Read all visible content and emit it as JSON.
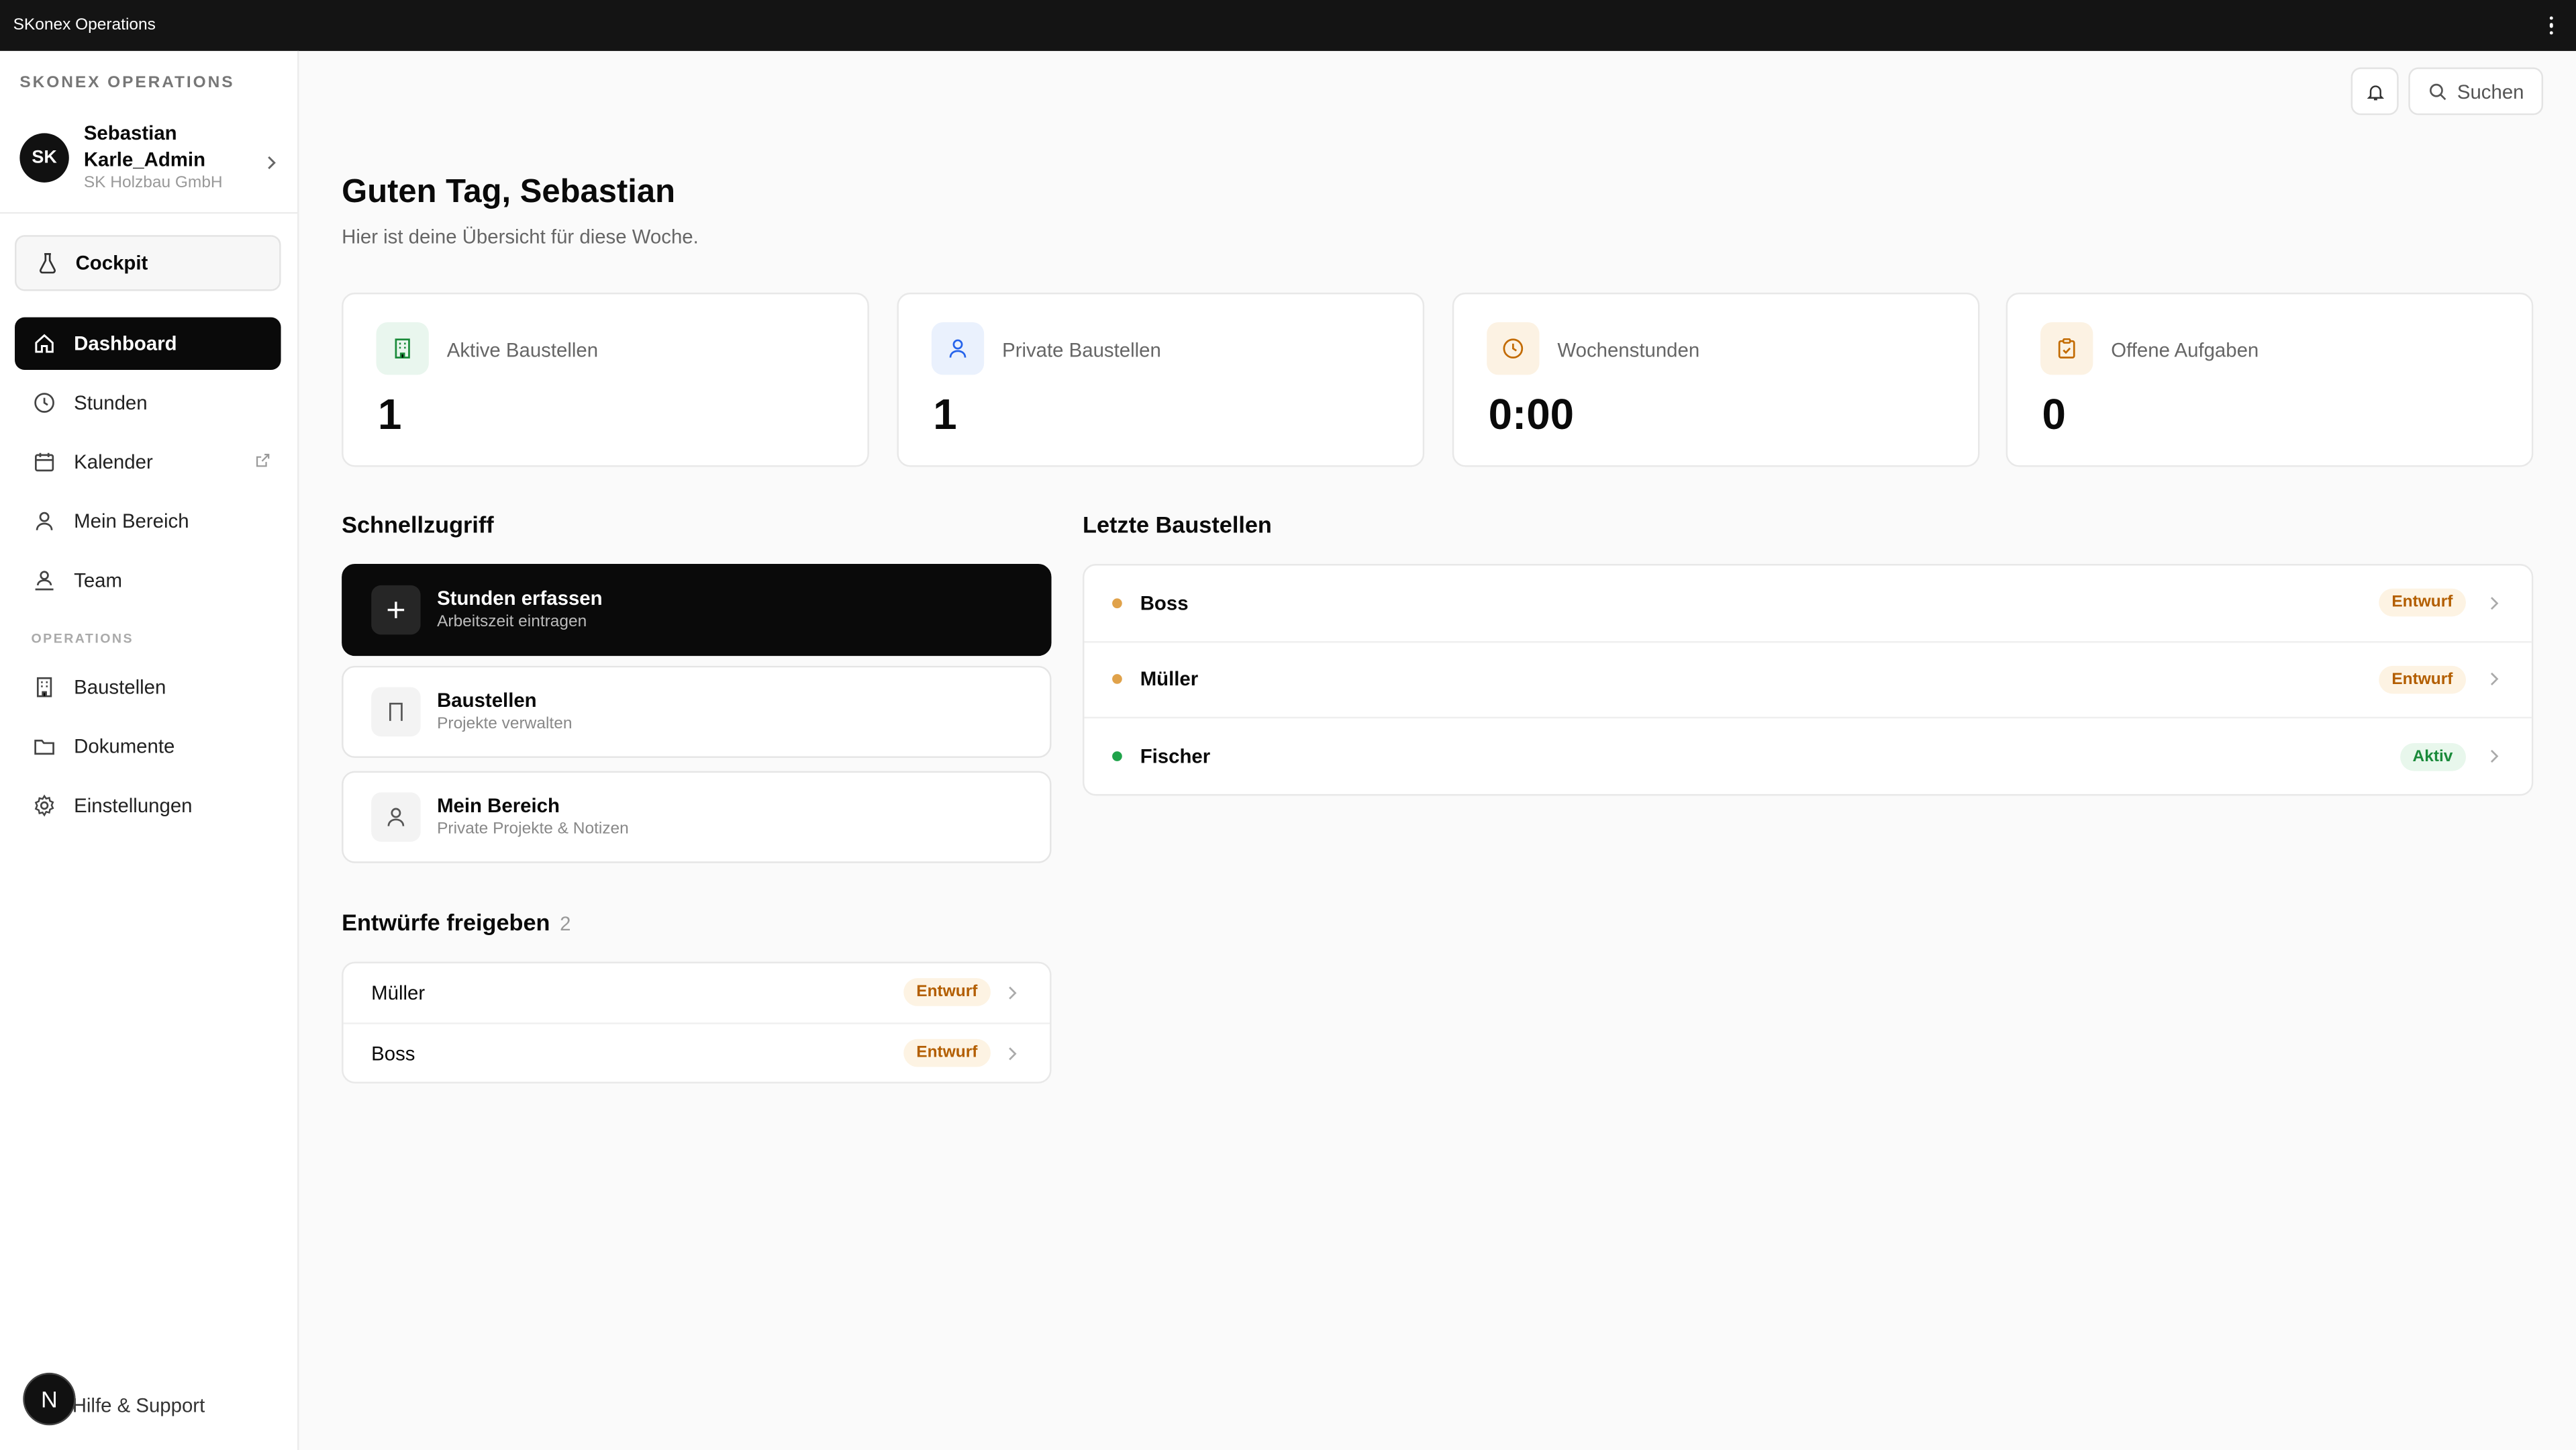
{
  "window": {
    "title": "SKonex Operations"
  },
  "sidebar": {
    "brand": "SKONEX OPERATIONS",
    "user": {
      "initials": "SK",
      "name": "Sebastian Karle_Admin",
      "company": "SK Holzbau GmbH"
    },
    "cockpit_label": "Cockpit",
    "items": [
      {
        "label": "Dashboard",
        "icon": "home-icon",
        "active": true
      },
      {
        "label": "Stunden",
        "icon": "clock-icon"
      },
      {
        "label": "Kalender",
        "icon": "calendar-icon",
        "external": true
      },
      {
        "label": "Mein Bereich",
        "icon": "user-icon"
      },
      {
        "label": "Team",
        "icon": "team-icon"
      }
    ],
    "section_label": "OPERATIONS",
    "ops_items": [
      {
        "label": "Baustellen",
        "icon": "building-icon"
      },
      {
        "label": "Dokumente",
        "icon": "folder-icon"
      },
      {
        "label": "Einstellungen",
        "icon": "gear-icon"
      }
    ],
    "help_label": "Hilfe & Support",
    "fab_letter": "N"
  },
  "header": {
    "search_label": "Suchen"
  },
  "main": {
    "greeting": "Guten Tag, Sebastian",
    "subtitle": "Hier ist deine Übersicht für diese Woche.",
    "stats": [
      {
        "label": "Aktive Baustellen",
        "value": "1",
        "icon": "building-icon",
        "color": "#1a8a3a",
        "bg": "#e9f6ee"
      },
      {
        "label": "Private Baustellen",
        "value": "1",
        "icon": "user-icon",
        "color": "#2563eb",
        "bg": "#eaf1fd"
      },
      {
        "label": "Wochenstunden",
        "value": "0:00",
        "icon": "clock-icon",
        "color": "#c26a00",
        "bg": "#fcf2e3"
      },
      {
        "label": "Offene Aufgaben",
        "value": "0",
        "icon": "clipboard-icon",
        "color": "#c26a00",
        "bg": "#fcf2e3"
      }
    ],
    "quick_title": "Schnellzugriff",
    "quick": [
      {
        "title": "Stunden erfassen",
        "subtitle": "Arbeitszeit eintragen"
      },
      {
        "title": "Baustellen",
        "subtitle": "Projekte verwalten"
      },
      {
        "title": "Mein Bereich",
        "subtitle": "Private Projekte & Notizen"
      }
    ],
    "recent_title": "Letzte Baustellen",
    "recent": [
      {
        "name": "Boss",
        "status": "Entwurf",
        "dot": "#e0a24a"
      },
      {
        "name": "Müller",
        "status": "Entwurf",
        "dot": "#e0a24a"
      },
      {
        "name": "Fischer",
        "status": "Aktiv",
        "dot": "#1fa34a"
      }
    ],
    "drafts_title": "Entwürfe freigeben",
    "drafts_count": "2",
    "drafts": [
      {
        "name": "Müller",
        "status": "Entwurf"
      },
      {
        "name": "Boss",
        "status": "Entwurf"
      }
    ]
  }
}
